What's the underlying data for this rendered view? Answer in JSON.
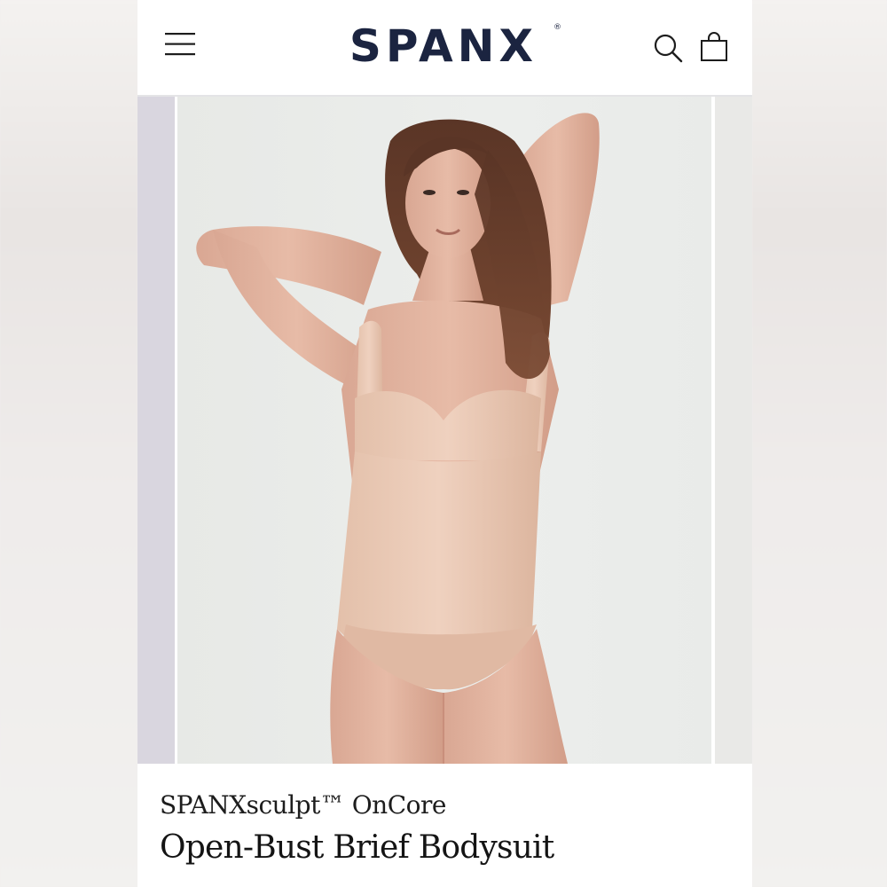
{
  "header": {
    "logo_text": "SPANX",
    "logo_mark": "®",
    "menu_icon": "hamburger-menu-icon",
    "search_icon": "search-icon",
    "cart_icon": "shopping-bag-icon",
    "brand_color": "#1b2440"
  },
  "carousel": {
    "image_alt": "Model wearing nude open-bust brief bodysuit"
  },
  "product": {
    "brand_line": "SPANXsculpt™ OnCore",
    "title": "Open-Bust Brief Bodysuit"
  }
}
